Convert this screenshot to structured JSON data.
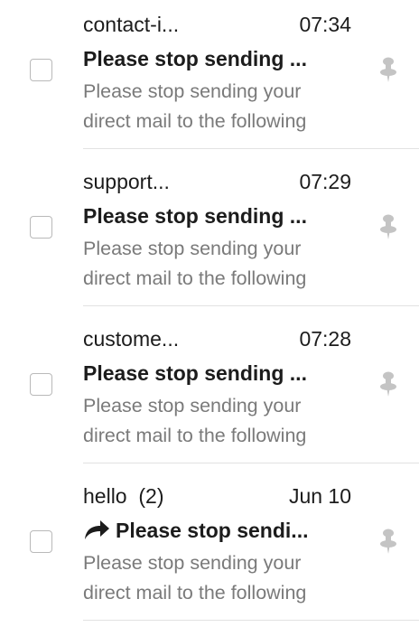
{
  "messages": [
    {
      "sender": "contact-i...",
      "time": "07:34",
      "subject": "Please stop sending ...",
      "preview_line1": "Please stop sending your",
      "preview_line2": "direct mail to the following",
      "replied": false,
      "icon": "pin-icon"
    },
    {
      "sender": "support...",
      "time": "07:29",
      "subject": "Please stop sending ...",
      "preview_line1": "Please stop sending your",
      "preview_line2": "direct mail to the following",
      "replied": false,
      "icon": "pin-icon"
    },
    {
      "sender": "custome...",
      "time": "07:28",
      "subject": "Please stop sending ...",
      "preview_line1": "Please stop sending your",
      "preview_line2": "direct mail to the following",
      "replied": false,
      "icon": "pin-icon"
    },
    {
      "sender": "hello  (2)",
      "time": "Jun 10",
      "subject": "Please stop sendi...",
      "preview_line1": "Please stop sending your",
      "preview_line2": "direct mail to the following",
      "replied": true,
      "icon": "pin-icon"
    }
  ],
  "colors": {
    "text": "#1c1c1c",
    "preview": "#7a7a7a",
    "divider": "#e2e2e2",
    "checkbox_border": "#b9b9b9",
    "pin": "#c4c4c4"
  }
}
